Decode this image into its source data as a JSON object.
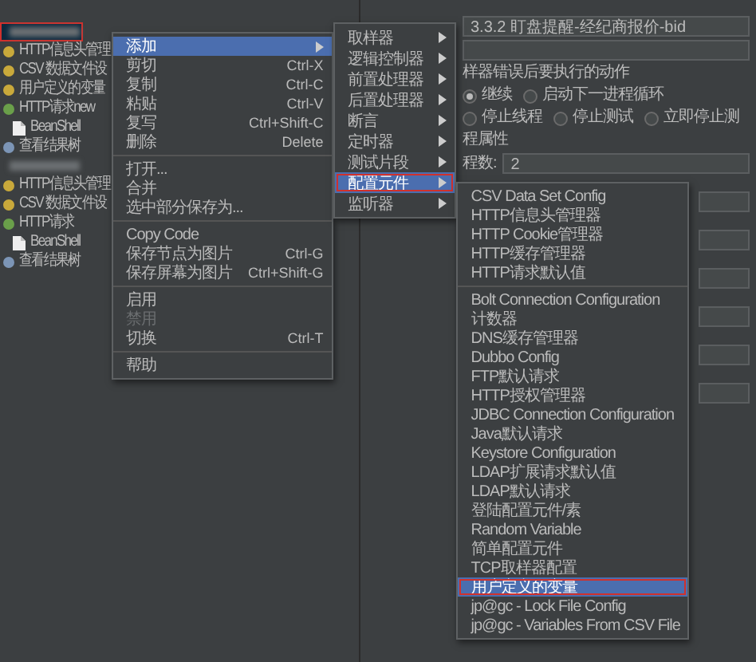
{
  "tree": {
    "items": [
      {
        "kind": "redacted",
        "selected": true,
        "outlined": true
      },
      {
        "kind": "config",
        "label": "HTTP信息头管理",
        "selected": false,
        "outlined": false
      },
      {
        "kind": "config",
        "label": "CSV 数据文件设",
        "selected": false,
        "outlined": false
      },
      {
        "kind": "config",
        "label": "用户定义的变量",
        "selected": false,
        "outlined": false
      },
      {
        "kind": "sampler",
        "label": "HTTP请求new",
        "selected": false,
        "outlined": false,
        "children": [
          {
            "kind": "script",
            "label": "BeanShell",
            "selected": false,
            "outlined": false
          }
        ]
      },
      {
        "kind": "listener",
        "label": "查看结果树",
        "selected": false,
        "outlined": false
      },
      {
        "kind": "redacted",
        "selected": false,
        "outlined": false
      },
      {
        "kind": "config",
        "label": "HTTP信息头管理",
        "selected": false,
        "outlined": false
      },
      {
        "kind": "config",
        "label": "CSV 数据文件设",
        "selected": false,
        "outlined": false
      },
      {
        "kind": "sampler",
        "label": "HTTP请求",
        "selected": false,
        "outlined": false,
        "children": [
          {
            "kind": "script",
            "label": "BeanShell",
            "selected": false,
            "outlined": false
          }
        ]
      },
      {
        "kind": "listener",
        "label": "查看结果树",
        "selected": false,
        "outlined": false
      }
    ]
  },
  "form": {
    "name_value": "3.3.2 盯盘提醒-经纪商报价-bid",
    "error_action_label": "样器错误后要执行的动作",
    "error_actions": [
      {
        "label": "继续",
        "selected": true
      },
      {
        "label": "启动下一进程循环",
        "selected": false
      },
      {
        "label": "停止线程",
        "selected": false
      },
      {
        "label": "停止测试",
        "selected": false
      },
      {
        "label": "立即停止测",
        "selected": false
      }
    ],
    "section_title": "程属性",
    "threads_label": "程数:",
    "threads_value": "2"
  },
  "context_menu": {
    "items": [
      {
        "kind": "item",
        "label": "添加",
        "submenu": true,
        "selected": true,
        "disabled": false
      },
      {
        "kind": "item",
        "label": "剪切",
        "shortcut": "Ctrl-X",
        "selected": false,
        "disabled": false
      },
      {
        "kind": "item",
        "label": "复制",
        "shortcut": "Ctrl-C",
        "selected": false,
        "disabled": false
      },
      {
        "kind": "item",
        "label": "粘贴",
        "shortcut": "Ctrl-V",
        "selected": false,
        "disabled": false
      },
      {
        "kind": "item",
        "label": "复写",
        "shortcut": "Ctrl+Shift-C",
        "selected": false,
        "disabled": false
      },
      {
        "kind": "item",
        "label": "删除",
        "shortcut": "Delete",
        "selected": false,
        "disabled": false
      },
      {
        "kind": "separator"
      },
      {
        "kind": "item",
        "label": "打开...",
        "selected": false,
        "disabled": false
      },
      {
        "kind": "item",
        "label": "合并",
        "selected": false,
        "disabled": false
      },
      {
        "kind": "item",
        "label": "选中部分保存为...",
        "selected": false,
        "disabled": false
      },
      {
        "kind": "separator"
      },
      {
        "kind": "item",
        "label": "Copy Code",
        "selected": false,
        "disabled": false
      },
      {
        "kind": "item",
        "label": "保存节点为图片",
        "shortcut": "Ctrl-G",
        "selected": false,
        "disabled": false
      },
      {
        "kind": "item",
        "label": "保存屏幕为图片",
        "shortcut": "Ctrl+Shift-G",
        "selected": false,
        "disabled": false
      },
      {
        "kind": "separator"
      },
      {
        "kind": "item",
        "label": "启用",
        "selected": false,
        "disabled": false
      },
      {
        "kind": "item",
        "label": "禁用",
        "selected": false,
        "disabled": true
      },
      {
        "kind": "item",
        "label": "切换",
        "shortcut": "Ctrl-T",
        "selected": false,
        "disabled": false
      },
      {
        "kind": "separator"
      },
      {
        "kind": "item",
        "label": "帮助",
        "selected": false,
        "disabled": false
      }
    ]
  },
  "add_submenu": {
    "items": [
      {
        "label": "取样器",
        "submenu": true,
        "selected": false,
        "outlined": false
      },
      {
        "label": "逻辑控制器",
        "submenu": true,
        "selected": false,
        "outlined": false
      },
      {
        "label": "前置处理器",
        "submenu": true,
        "selected": false,
        "outlined": false
      },
      {
        "label": "后置处理器",
        "submenu": true,
        "selected": false,
        "outlined": false
      },
      {
        "label": "断言",
        "submenu": true,
        "selected": false,
        "outlined": false
      },
      {
        "label": "定时器",
        "submenu": true,
        "selected": false,
        "outlined": false
      },
      {
        "label": "测试片段",
        "submenu": true,
        "selected": false,
        "outlined": false
      },
      {
        "label": "配置元件",
        "submenu": true,
        "selected": true,
        "outlined": true
      },
      {
        "label": "监听器",
        "submenu": true,
        "selected": false,
        "outlined": false
      }
    ]
  },
  "config_submenu": {
    "items": [
      {
        "kind": "item",
        "label": "CSV Data Set Config",
        "selected": false,
        "outlined": false
      },
      {
        "kind": "item",
        "label": "HTTP信息头管理器",
        "selected": false,
        "outlined": false
      },
      {
        "kind": "item",
        "label": "HTTP Cookie管理器",
        "selected": false,
        "outlined": false
      },
      {
        "kind": "item",
        "label": "HTTP缓存管理器",
        "selected": false,
        "outlined": false
      },
      {
        "kind": "item",
        "label": "HTTP请求默认值",
        "selected": false,
        "outlined": false
      },
      {
        "kind": "separator"
      },
      {
        "kind": "item",
        "label": "Bolt Connection Configuration",
        "selected": false,
        "outlined": false
      },
      {
        "kind": "item",
        "label": "计数器",
        "selected": false,
        "outlined": false
      },
      {
        "kind": "item",
        "label": "DNS缓存管理器",
        "selected": false,
        "outlined": false
      },
      {
        "kind": "item",
        "label": "Dubbo Config",
        "selected": false,
        "outlined": false
      },
      {
        "kind": "item",
        "label": "FTP默认请求",
        "selected": false,
        "outlined": false
      },
      {
        "kind": "item",
        "label": "HTTP授权管理器",
        "selected": false,
        "outlined": false
      },
      {
        "kind": "item",
        "label": "JDBC Connection Configuration",
        "selected": false,
        "outlined": false
      },
      {
        "kind": "item",
        "label": "Java默认请求",
        "selected": false,
        "outlined": false
      },
      {
        "kind": "item",
        "label": "Keystore Configuration",
        "selected": false,
        "outlined": false
      },
      {
        "kind": "item",
        "label": "LDAP扩展请求默认值",
        "selected": false,
        "outlined": false
      },
      {
        "kind": "item",
        "label": "LDAP默认请求",
        "selected": false,
        "outlined": false
      },
      {
        "kind": "item",
        "label": "登陆配置元件/素",
        "selected": false,
        "outlined": false
      },
      {
        "kind": "item",
        "label": "Random Variable",
        "selected": false,
        "outlined": false
      },
      {
        "kind": "item",
        "label": "简单配置元件",
        "selected": false,
        "outlined": false
      },
      {
        "kind": "item",
        "label": "TCP取样器配置",
        "selected": false,
        "outlined": false
      },
      {
        "kind": "item",
        "label": "用户定义的变量",
        "selected": true,
        "outlined": true
      },
      {
        "kind": "item",
        "label": "jp@gc - Lock File Config",
        "selected": false,
        "outlined": false
      },
      {
        "kind": "item",
        "label": "jp@gc - Variables From CSV File",
        "selected": false,
        "outlined": false
      }
    ]
  }
}
